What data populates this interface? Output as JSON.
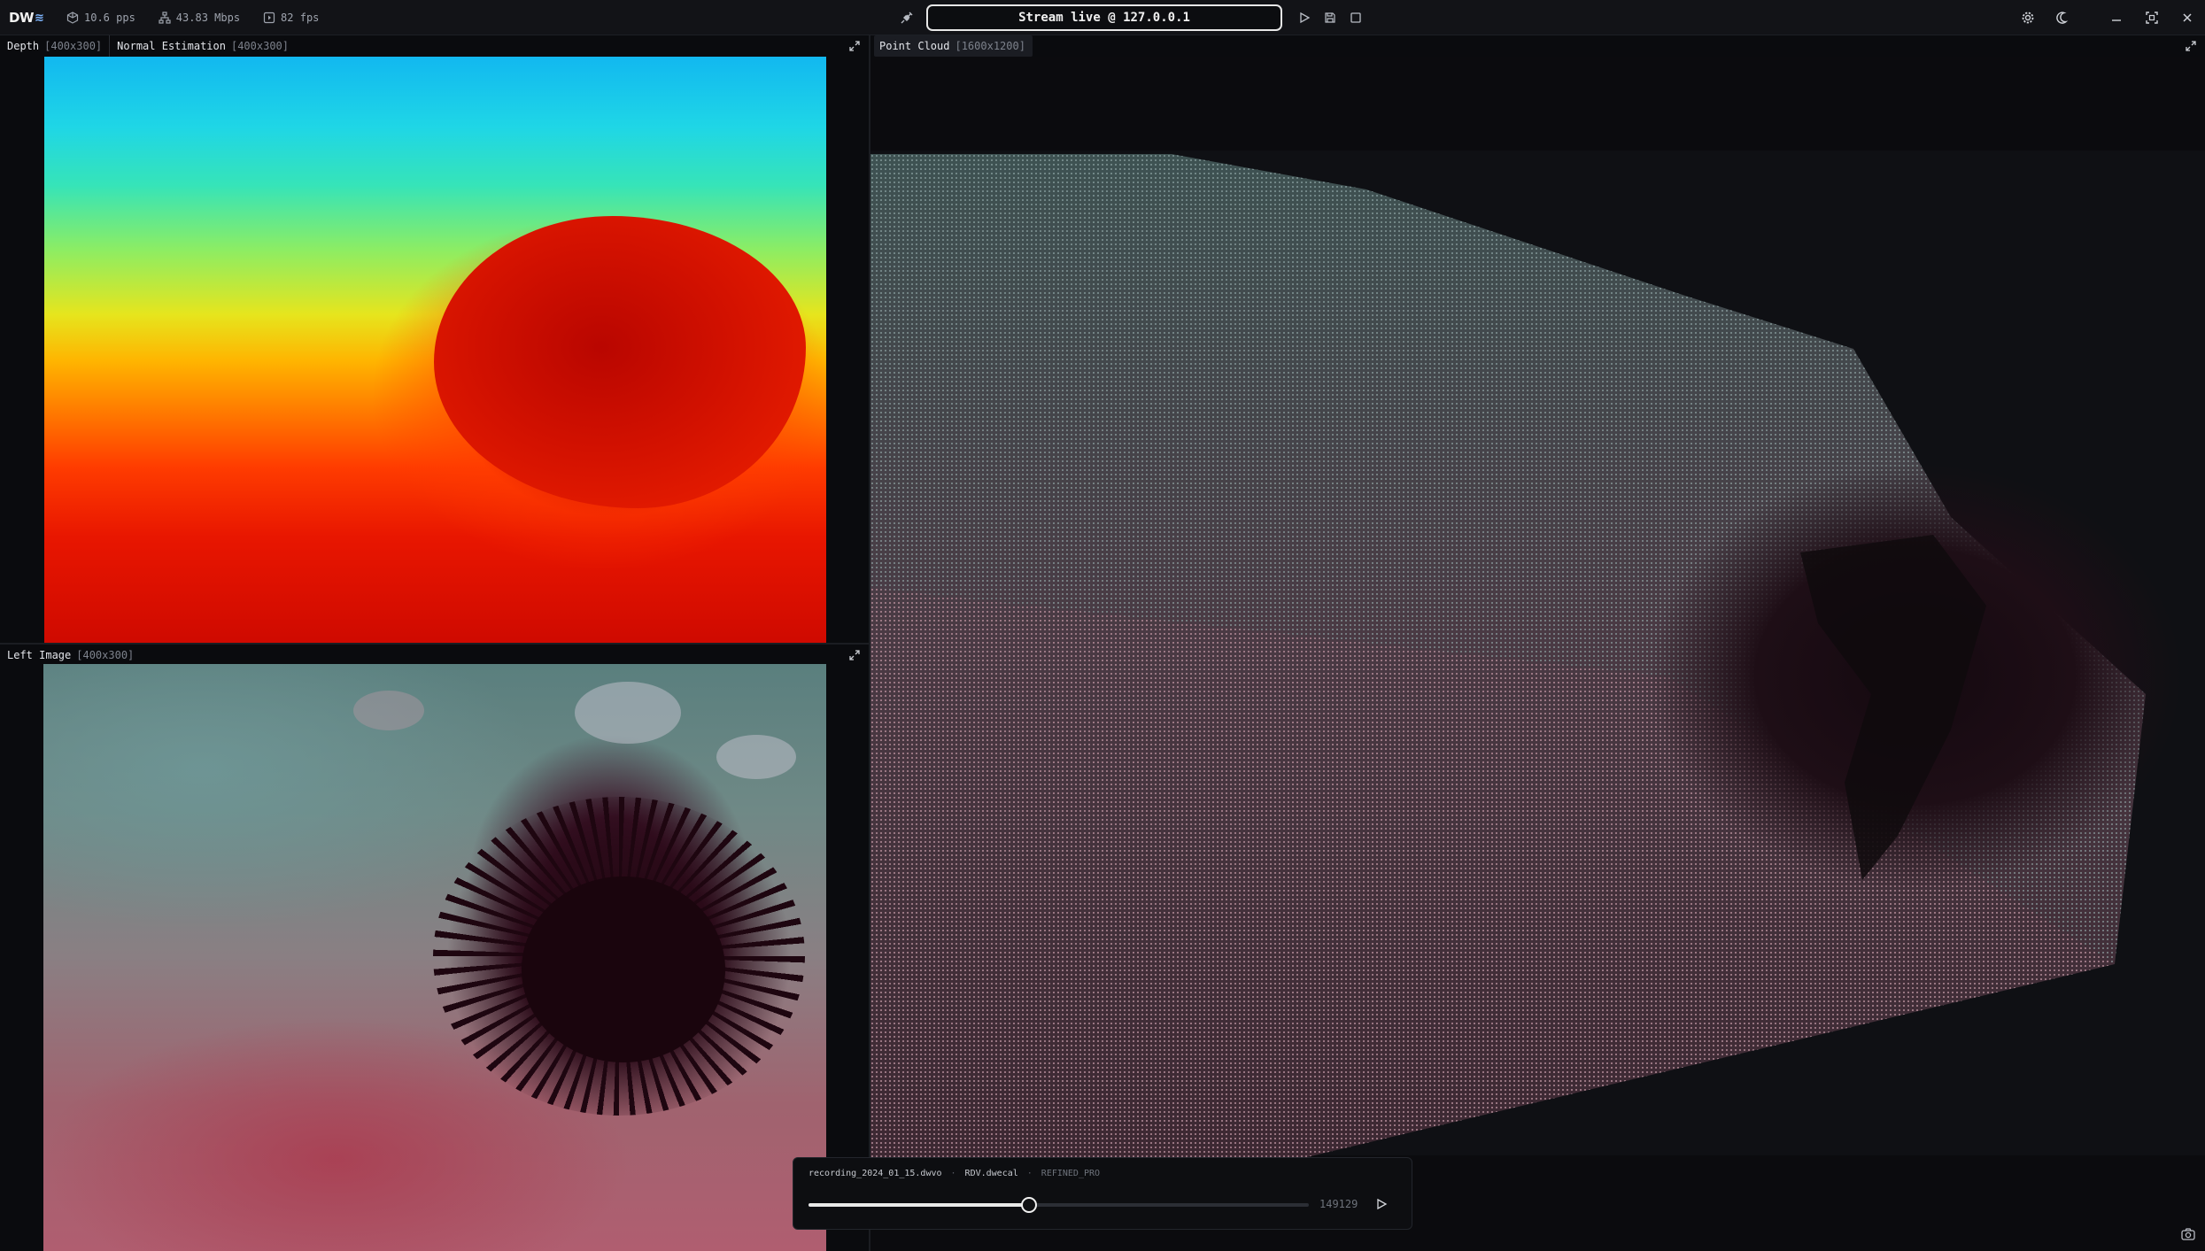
{
  "app": {
    "logo_text": "DW",
    "stats": {
      "points": "10.6 pps",
      "bandwidth": "43.83 Mbps",
      "fps": "82 fps"
    },
    "stream_status": "Stream live @ 127.0.0.1"
  },
  "panels": {
    "depth": {
      "name": "Depth",
      "resolution": "[400x300]"
    },
    "normal": {
      "name": "Normal Estimation",
      "resolution": "[400x300]"
    },
    "left_image": {
      "name": "Left Image",
      "resolution": "[400x300]"
    },
    "point_cloud": {
      "name": "Point Cloud",
      "resolution": "[1600x1200]"
    }
  },
  "playback": {
    "file": "recording_2024_01_15.dwvo",
    "calibration": "RDV.dwecal",
    "mode": "REFINED_PRO",
    "frame": "149129",
    "progress": 0.44
  },
  "colors": {
    "accent": "#7fb6ff",
    "stream_border": "#e7e7e7",
    "panel_bg": "#0a0b0e"
  },
  "icons": [
    "logo-icon",
    "cube-icon",
    "network-icon",
    "fps-icon",
    "plug-icon",
    "play-icon",
    "save-icon",
    "stop-icon",
    "settings-icon",
    "moon-icon",
    "minimize-icon",
    "fullscreen-icon",
    "close-icon",
    "expand-icon",
    "camera-icon"
  ]
}
